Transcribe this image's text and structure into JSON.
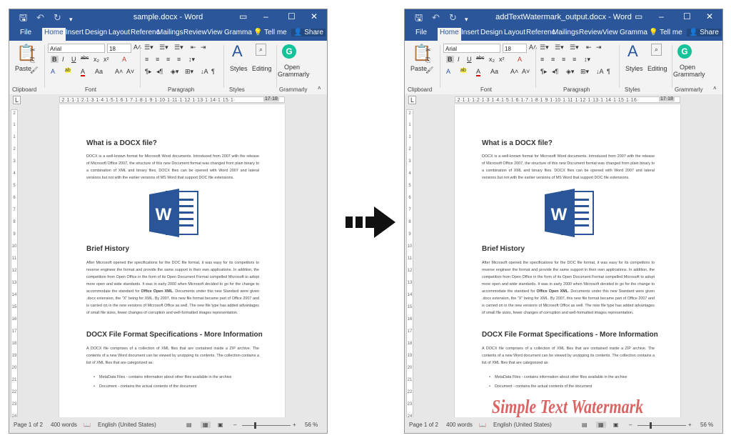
{
  "windows": [
    {
      "id": "left",
      "title": "sample.docx - Word",
      "tabs": [
        "File",
        "Home",
        "Insert",
        "Design",
        "Layout",
        "Referenc",
        "Mailings",
        "Review",
        "View",
        "Gramma",
        "Tell me",
        "Share"
      ],
      "active_tab": "Home",
      "font_name": "Arial",
      "font_size": "18",
      "groups": [
        "Clipboard",
        "Font",
        "Paragraph",
        "Styles",
        "Grammarly"
      ],
      "ribbon_buttons": {
        "paste": "Paste",
        "styles": "Styles",
        "editing": "Editing",
        "open_grammarly": "Open Grammarly"
      },
      "ruler_text": "·2·1·1·1·2·1·3·1·4·1·5·1·6·1·7·1·8·1·9·1·10·1·11·1·12·1·13·1·14·1·15·1·",
      "ruler_end": "17·18",
      "status": {
        "page": "Page 1 of 2",
        "words": "400 words",
        "language": "English (United States)",
        "zoom": "56 %"
      },
      "watermark": ""
    },
    {
      "id": "right",
      "title": "addTextWatermark_output.docx - Word",
      "tabs": [
        "File",
        "Home",
        "Insert",
        "Design",
        "Layout",
        "Referenc",
        "Mailings",
        "Review",
        "View",
        "Gramma",
        "Tell me",
        "Share"
      ],
      "active_tab": "Home",
      "font_name": "Arial",
      "font_size": "18",
      "groups": [
        "Clipboard",
        "Font",
        "Paragraph",
        "Styles",
        "Grammarly"
      ],
      "ribbon_buttons": {
        "paste": "Paste",
        "styles": "Styles",
        "editing": "Editing",
        "open_grammarly": "Open Grammarly"
      },
      "ruler_text": "·2·1·1·1·2·1·3·1·4·1·5·1·6·1·7·1·8·1·9·1·10·1·11·1·12·1·13·1·14·1·15·1·16·",
      "ruler_end": "17·18",
      "status": {
        "page": "Page 1 of 2",
        "words": "400 words",
        "language": "English (United States)",
        "zoom": "56 %"
      },
      "watermark": "Simple Text Watermark"
    }
  ],
  "document": {
    "h1": "What is a DOCX file?",
    "p1": "DOCX is a well-known format for Microsoft Word documents. Introduced from 2007 with the release of Microsoft Office 2007, the structure of this new Document format was changed from plain binary to a combination of XML and binary files. DOCX files can be opened with Word 2007 and lateral versions but not with the earlier versions of MS Word that support DOC file extensions.",
    "logo_letter": "W",
    "h2": "Brief History",
    "p2a": "After Microsoft opened the specifications for the DOC file format, it was easy for its competitors to reverse engineer the format and provide the same support in their own applications. In addition, the competition from Open Office in the form of its Open Document Format compelled Microsoft to adopt more open and wide standards. It was in early 2000 when Microsoft decided to go for the change to accommodate the standard for ",
    "p2b": "Office Open XML",
    "p2c": ". Documents under this new Standard were given .docx extension, the \"X\" being for XML. By 2007, this new file format became part of Office 2007 and is carried on in the new versions of Microsoft Office as well. The new file type has added advantages of small file sizes, fewer changes of corruption and well-formatted images representation.",
    "h3": "DOCX File Format Specifications - More Information",
    "p3": "A DOCX file comprises of a collection of XML files that are contained inside a ZIP archive. The contents of a new Word document can be viewed by unzipping its contents. The collection contains a list of XML files that are categorized as:",
    "bullets": [
      "MetaData Files - contains information about other files available in the archive",
      "Document - contains the actual contents of the document"
    ]
  },
  "colors": {
    "word_blue": "#2b579a",
    "logo_blue": "#2a5699",
    "grammarly_green": "#15c39a",
    "watermark_red": "#d23c3c"
  }
}
